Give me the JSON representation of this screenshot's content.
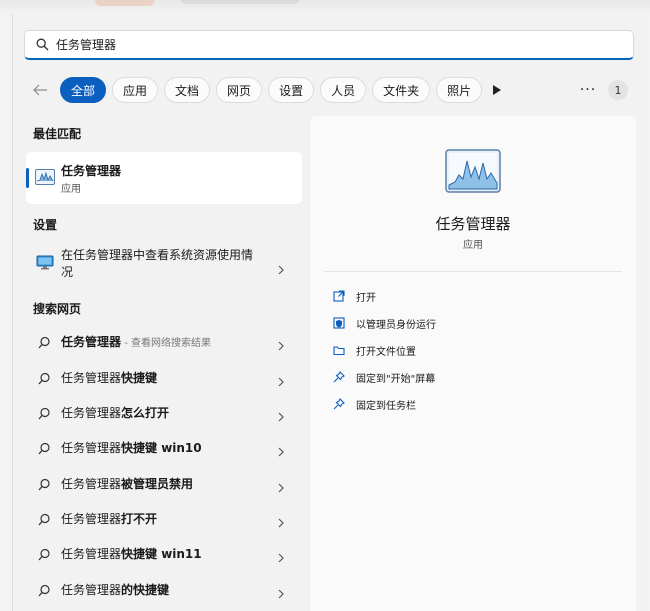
{
  "search": {
    "value": "任务管理器"
  },
  "filters": [
    {
      "label": "全部",
      "active": true
    },
    {
      "label": "应用"
    },
    {
      "label": "文档"
    },
    {
      "label": "网页"
    },
    {
      "label": "设置"
    },
    {
      "label": "人员"
    },
    {
      "label": "文件夹"
    },
    {
      "label": "照片"
    }
  ],
  "more_label": "···",
  "result_count": "1",
  "sections": {
    "best_match": "最佳匹配",
    "settings": "设置",
    "web": "搜索网页"
  },
  "best_match": {
    "name": "任务管理器",
    "type": "应用"
  },
  "settings_item": {
    "text": "在任务管理器中查看系统资源使用情况"
  },
  "web_results": [
    {
      "bold": "任务管理器",
      "normal": "",
      "hint": " - 查看网络搜索结果"
    },
    {
      "bold": "",
      "normal": "任务管理器",
      "boldSuffix": "快捷键"
    },
    {
      "bold": "",
      "normal": "任务管理器",
      "boldSuffix": "怎么打开"
    },
    {
      "bold": "",
      "normal": "任务管理器",
      "boldSuffix": "快捷键 win10"
    },
    {
      "bold": "",
      "normal": "任务管理器",
      "boldSuffix": "被管理员禁用"
    },
    {
      "bold": "",
      "normal": "任务管理器",
      "boldSuffix": "打不开"
    },
    {
      "bold": "",
      "normal": "任务管理器",
      "boldSuffix": "快捷键 win11"
    },
    {
      "bold": "",
      "normal": "任务管理器",
      "boldSuffix": "的快捷键"
    }
  ],
  "detail": {
    "title": "任务管理器",
    "subtitle": "应用",
    "actions": [
      {
        "label": "打开",
        "icon": "open-icon"
      },
      {
        "label": "以管理员身份运行",
        "icon": "shield-icon"
      },
      {
        "label": "打开文件位置",
        "icon": "folder-icon"
      },
      {
        "label": "固定到\"开始\"屏幕",
        "icon": "pin-icon"
      },
      {
        "label": "固定到任务栏",
        "icon": "pin-icon"
      }
    ]
  },
  "colors": {
    "accent": "#0a5fbf",
    "panel": "#f2f2f2",
    "card": "#ffffff"
  }
}
